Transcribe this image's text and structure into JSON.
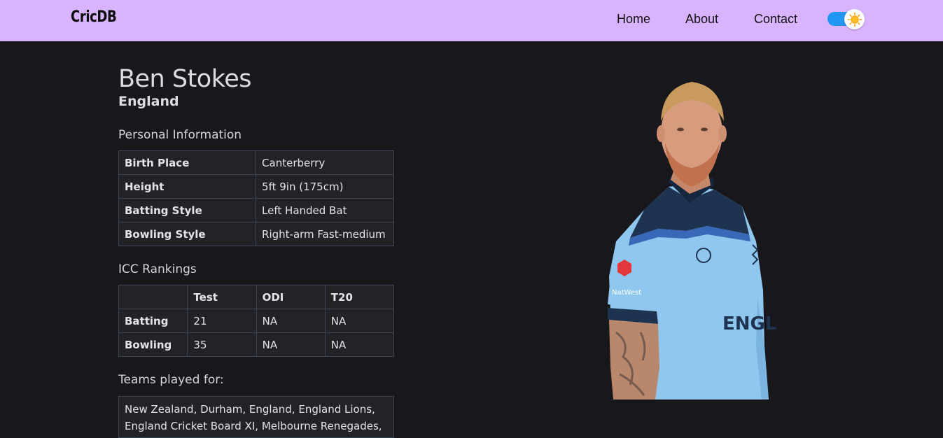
{
  "nav": {
    "brand": "CricDB",
    "links": [
      "Home",
      "About",
      "Contact"
    ],
    "theme_toggle": {
      "state": "on",
      "icon": "sun-icon",
      "accent": "#2196f3"
    },
    "background": "#d8b4fe"
  },
  "player": {
    "name": "Ben Stokes",
    "country": "England"
  },
  "personal": {
    "title": "Personal Information",
    "rows": [
      {
        "label": "Birth Place",
        "value": "Canterberry"
      },
      {
        "label": "Height",
        "value": "5ft 9in (175cm)"
      },
      {
        "label": "Batting Style",
        "value": "Left Handed Bat"
      },
      {
        "label": "Bowling Style",
        "value": "Right-arm Fast-medium"
      }
    ]
  },
  "rankings": {
    "title": "ICC Rankings",
    "headers": [
      "",
      "Test",
      "ODI",
      "T20"
    ],
    "rows": [
      {
        "label": "Batting",
        "test": "21",
        "odi": "NA",
        "t20": "NA"
      },
      {
        "label": "Bowling",
        "test": "35",
        "odi": "NA",
        "t20": "NA"
      }
    ]
  },
  "teams": {
    "title": "Teams played for:",
    "text": "New Zealand, Durham, England, England Lions, England Cricket Board XI, Melbourne Renegades,"
  },
  "image": {
    "jersey_text": "ENGLAND",
    "sponsor": "NatWest"
  }
}
